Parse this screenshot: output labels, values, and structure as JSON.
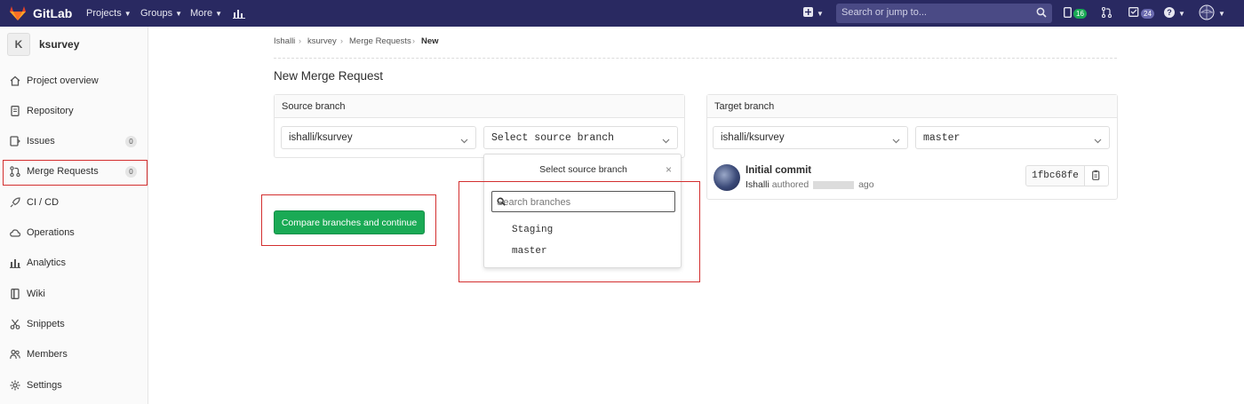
{
  "navbar": {
    "brand": "GitLab",
    "menu": [
      {
        "label": "Projects"
      },
      {
        "label": "Groups"
      },
      {
        "label": "More"
      }
    ],
    "search_placeholder": "Search or jump to...",
    "todos_count": "16",
    "issues_count": "24"
  },
  "sidebar": {
    "project_initial": "K",
    "project_name": "ksurvey",
    "items": [
      {
        "label": "Project overview",
        "icon": "home-icon"
      },
      {
        "label": "Repository",
        "icon": "doc-icon"
      },
      {
        "label": "Issues",
        "icon": "issues-icon",
        "count": "0"
      },
      {
        "label": "Merge Requests",
        "icon": "merge-request-icon",
        "count": "0"
      },
      {
        "label": "CI / CD",
        "icon": "rocket-icon"
      },
      {
        "label": "Operations",
        "icon": "cloud-icon"
      },
      {
        "label": "Analytics",
        "icon": "chart-icon"
      },
      {
        "label": "Wiki",
        "icon": "book-icon"
      },
      {
        "label": "Snippets",
        "icon": "scissors-icon"
      },
      {
        "label": "Members",
        "icon": "users-icon"
      },
      {
        "label": "Settings",
        "icon": "gear-icon"
      }
    ]
  },
  "breadcrumb": [
    "Ishalli",
    "ksurvey",
    "Merge Requests",
    "New"
  ],
  "page_title": "New Merge Request",
  "source": {
    "heading": "Source branch",
    "project": "ishalli/ksurvey",
    "branch_placeholder": "Select source branch"
  },
  "target": {
    "heading": "Target branch",
    "project": "ishalli/ksurvey",
    "branch": "master"
  },
  "compare_button": "Compare branches and continue",
  "branch_dropdown": {
    "title": "Select source branch",
    "close": "×",
    "search_placeholder": "Search branches",
    "options": [
      "Staging",
      "master"
    ]
  },
  "commit": {
    "title": "Initial commit",
    "author": "Ishalli",
    "authored_word": "authored",
    "ago_word": "ago",
    "sha": "1fbc68fe"
  },
  "colors": {
    "navbar": "#292961",
    "primary_button": "#1aaa55",
    "highlight_box": "#d32f2f"
  }
}
